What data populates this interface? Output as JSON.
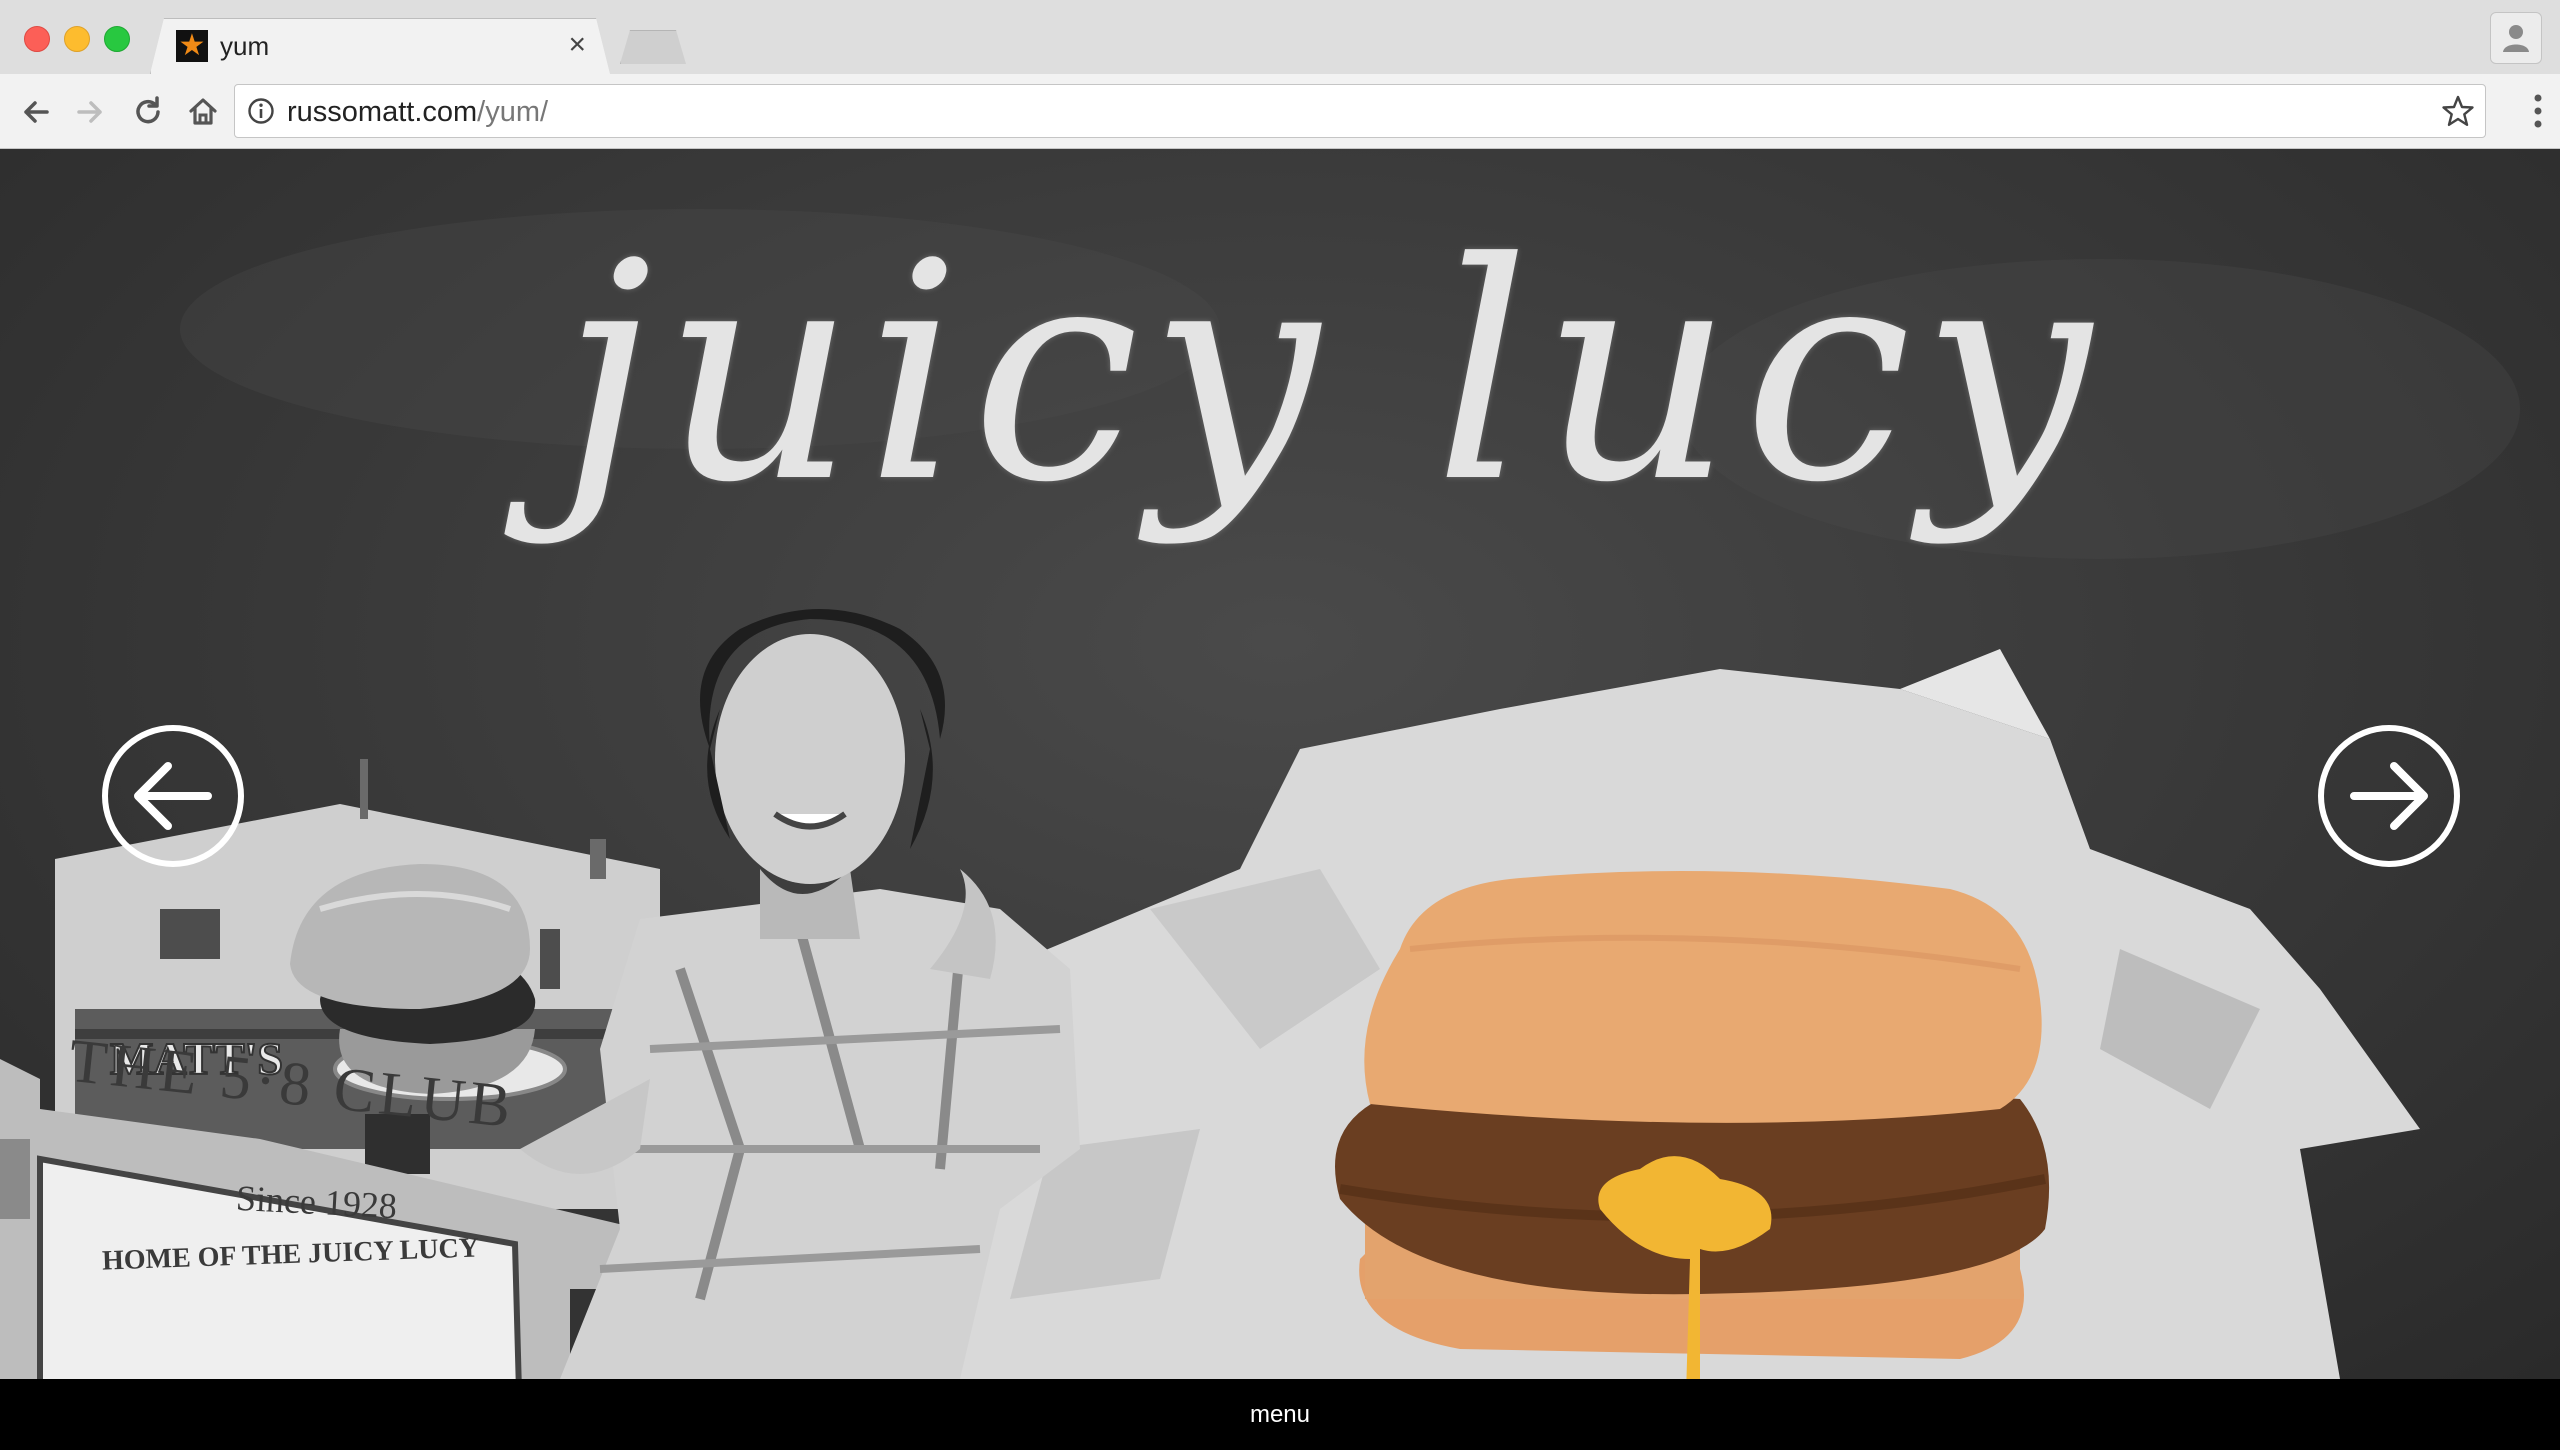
{
  "browser": {
    "tab_title": "yum",
    "url_host": "russomatt.com",
    "url_path": "/yum/",
    "close_glyph": "×",
    "favicon_glyph": "★"
  },
  "page": {
    "headline": "juicy lucy",
    "sign": {
      "line1": "THE 5·8 CLUB",
      "line2": "Since 1928",
      "line3": "HOME OF THE JUICY LUCY"
    },
    "building_sign": "MATT'S",
    "menu_label": "menu"
  },
  "colors": {
    "chalkboard": "#3a3a3a",
    "bun": "#e7a66b",
    "patty": "#6b3f22",
    "cheese": "#f3b834"
  },
  "icons": [
    "back-arrow-icon",
    "forward-arrow-icon",
    "reload-icon",
    "home-icon",
    "info-icon",
    "bookmark-star-icon",
    "kebab-menu-icon",
    "profile-icon",
    "prev-slide-arrow-icon",
    "next-slide-arrow-icon"
  ]
}
